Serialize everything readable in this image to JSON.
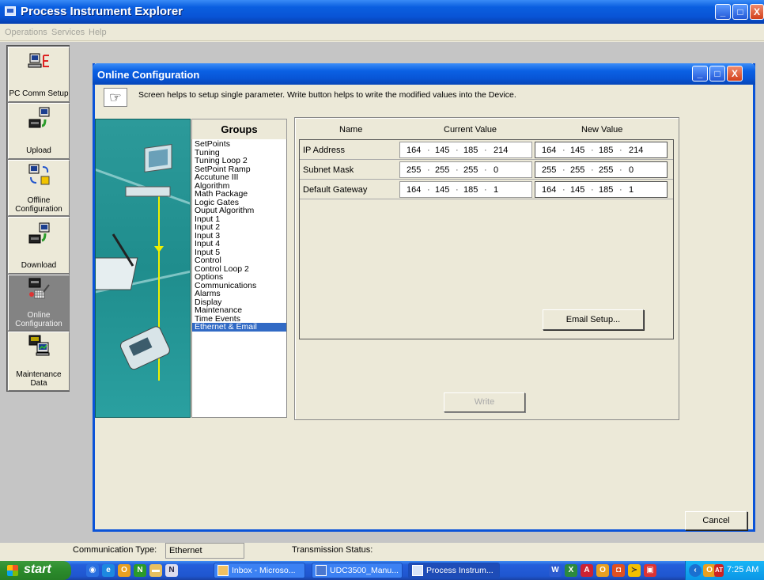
{
  "window": {
    "title": "Process Instrument Explorer",
    "controls": {
      "minimize": "_",
      "maximize": "□",
      "close": "X"
    }
  },
  "menu": [
    "Operations",
    "Services",
    "Help"
  ],
  "sidebar": {
    "items": [
      {
        "label": "PC Comm Setup",
        "icon": "pc-comm-icon",
        "active": false
      },
      {
        "label": "Upload",
        "icon": "upload-icon",
        "active": false
      },
      {
        "label": "Offline Configuration",
        "icon": "offline-config-icon",
        "active": false
      },
      {
        "label": "Download",
        "icon": "download-icon",
        "active": false
      },
      {
        "label": "Online Configuration",
        "icon": "online-config-icon",
        "active": true
      },
      {
        "label": "Maintenance Data",
        "icon": "maintenance-icon",
        "active": false
      }
    ]
  },
  "dialog": {
    "title": "Online Configuration",
    "info_text": "Screen helps to setup single parameter. Write button helps to write the modified values into the Device.",
    "groups_header": "Groups",
    "groups": [
      "SetPoints",
      "Tuning",
      "Tuning Loop 2",
      "SetPoint Ramp",
      "Accutune III",
      "Algorithm",
      "Math Package",
      "Logic Gates",
      "Ouput Algorithm",
      "Input 1",
      "Input 2",
      "Input 3",
      "Input 4",
      "Input 5",
      "Control",
      "Control Loop 2",
      "Options",
      "Communications",
      "Alarms",
      "Display",
      "Maintenance",
      "Time Events",
      "Ethernet & Email"
    ],
    "selected_group": "Ethernet & Email",
    "columns": {
      "name": "Name",
      "current": "Current Value",
      "new": "New Value"
    },
    "rows": [
      {
        "name": "IP Address",
        "current": [
          "164",
          "145",
          "185",
          "214"
        ],
        "new": [
          "164",
          "145",
          "185",
          "214"
        ]
      },
      {
        "name": "Subnet Mask",
        "current": [
          "255",
          "255",
          "255",
          "0"
        ],
        "new": [
          "255",
          "255",
          "255",
          "0"
        ]
      },
      {
        "name": "Default Gateway",
        "current": [
          "164",
          "145",
          "185",
          "1"
        ],
        "new": [
          "164",
          "145",
          "185",
          "1"
        ]
      }
    ],
    "email_setup_label": "Email Setup...",
    "write_label": "Write",
    "cancel_label": "Cancel"
  },
  "statusbar": {
    "comm_type_label": "Communication Type:",
    "comm_type_value": "Ethernet",
    "transmission_label": "Transmission Status:"
  },
  "taskbar": {
    "start_label": "start",
    "tasks": [
      "Inbox - Microso...",
      "UDC3500_Manu...",
      "Process Instrum..."
    ],
    "clock": "7:25 AM"
  }
}
